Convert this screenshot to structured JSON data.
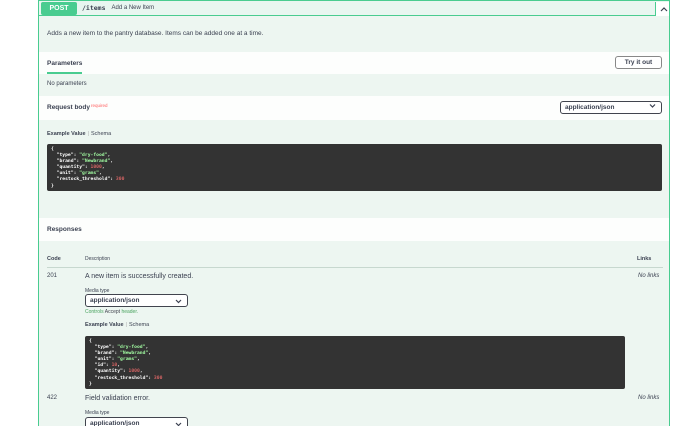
{
  "operation": {
    "method": "POST",
    "path": "/items",
    "summary": "Add a New Item",
    "description": "Adds a new item to the pantry database. Items can be added one at a time.",
    "collapse_icon": "chevron-up-icon"
  },
  "parameters": {
    "tab_label": "Parameters",
    "try_button": "Try it out",
    "empty_text": "No parameters"
  },
  "request_body": {
    "label": "Request body",
    "required": "required",
    "content_type": "application/json",
    "tab_example": "Example Value",
    "tab_schema": "Schema",
    "example_lines": [
      "{",
      "  \"type\": \"dry-food\",",
      "  \"brand\": \"Newbrand\",",
      "  \"quantity\": 1000,",
      "  \"unit\": \"grams\",",
      "  \"restock_threshold\": 300",
      "}"
    ]
  },
  "responses": {
    "title": "Responses",
    "col_code": "Code",
    "col_description": "Description",
    "col_links": "Links",
    "items": [
      {
        "code": "201",
        "description": "A new item is successfully created.",
        "links": "No links",
        "media_label": "Media type",
        "media_type": "application/json",
        "accept_prefix": "Controls",
        "accept_word": "Accept",
        "accept_suffix": "header.",
        "tab_example": "Example Value",
        "tab_schema": "Schema",
        "example_lines": [
          "{",
          "  \"type\": \"dry-food\",",
          "  \"brand\": \"Newbrand\",",
          "  \"unit\": \"grams\",",
          "  \"id\": 10,",
          "  \"quantity\": 1000,",
          "  \"restock_threshold\": 300",
          "}"
        ]
      },
      {
        "code": "422",
        "description": "Field validation error.",
        "links": "No links",
        "media_label": "Media type",
        "media_type": "application/json"
      }
    ]
  },
  "colors": {
    "post_green": "#49cc90",
    "op_background": "#edf6f1",
    "code_background": "#333333",
    "string_color": "#a2fca2",
    "number_color": "#d36363"
  }
}
